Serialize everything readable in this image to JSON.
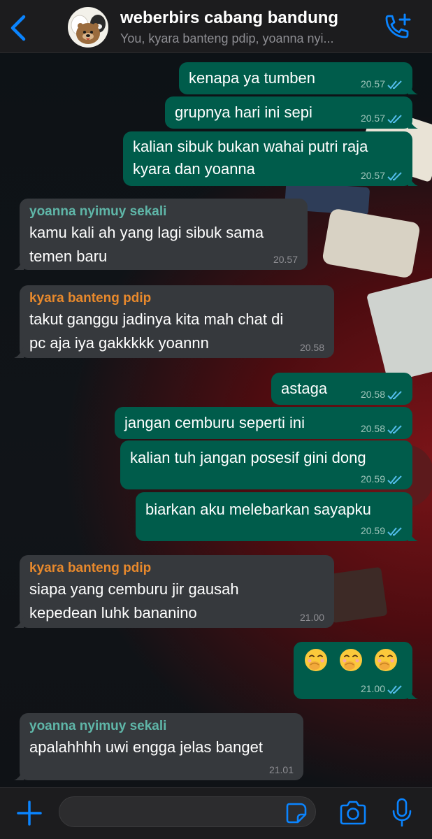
{
  "header": {
    "back_icon": "chevron-left-icon",
    "title": "weberbirs cabang bandung",
    "subtitle": "You, kyara banteng pdip, yoanna nyi...",
    "call_icon": "phone-add-icon"
  },
  "colors": {
    "accent": "#0a84ff",
    "outgoing_bubble": "#005c4b",
    "incoming_bubble": "#36393d",
    "sender_green": "#5fb6a8",
    "sender_orange": "#e8892c"
  },
  "messages": [
    {
      "dir": "out",
      "text": "kenapa ya tumben",
      "time": "20.57",
      "status": "read"
    },
    {
      "dir": "out",
      "text": "grupnya hari ini sepi",
      "time": "20.57",
      "status": "read"
    },
    {
      "dir": "out",
      "line1": "kalian sibuk bukan wahai putri raja",
      "line2": "kyara dan yoanna",
      "time": "20.57",
      "status": "read"
    },
    {
      "dir": "in",
      "sender": "yoanna nyimuy sekali",
      "line1": "kamu kali ah yang lagi sibuk sama",
      "line2": "temen baru",
      "time": "20.57"
    },
    {
      "dir": "in",
      "sender": "kyara banteng pdip",
      "line1": "takut ganggu jadinya kita mah chat di",
      "line2": "pc aja iya gakkkkk yoannn",
      "time": "20.58"
    },
    {
      "dir": "out",
      "text": "astaga",
      "time": "20.58",
      "status": "read"
    },
    {
      "dir": "out",
      "text": "jangan cemburu seperti ini",
      "time": "20.58",
      "status": "read"
    },
    {
      "dir": "out",
      "text": "kalian tuh jangan posesif gini dong",
      "time": "20.59",
      "status": "read"
    },
    {
      "dir": "out",
      "text": "biarkan aku melebarkan sayapku",
      "time": "20.59",
      "status": "read"
    },
    {
      "dir": "in",
      "sender": "kyara banteng pdip",
      "line1": "siapa yang cemburu jir gausah",
      "line2": "kepedean luhk bananino",
      "time": "21.00"
    },
    {
      "dir": "out",
      "emoji": "face-with-hand-over-mouth x3",
      "time": "21.00",
      "status": "read"
    },
    {
      "dir": "in",
      "sender": "yoanna nyimuy sekali",
      "text": "apalahhhh uwi engga jelas banget",
      "time": "21.01"
    }
  ],
  "compose": {
    "plus_icon": "plus-icon",
    "sticker_icon": "sticker-icon",
    "camera_icon": "camera-icon",
    "mic_icon": "microphone-icon"
  }
}
